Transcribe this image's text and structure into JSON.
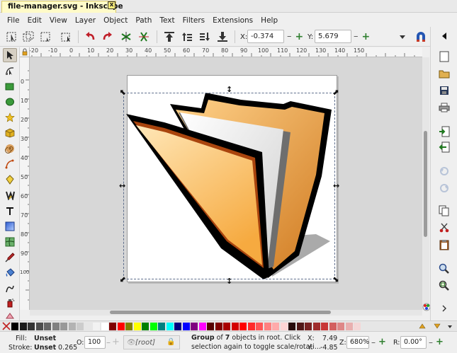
{
  "window": {
    "title_tab": "file-manager.svg - Inkscape",
    "close_glyph": "x"
  },
  "menubar": {
    "items": [
      "File",
      "Edit",
      "View",
      "Layer",
      "Object",
      "Path",
      "Text",
      "Filters",
      "Extensions",
      "Help"
    ]
  },
  "tool_controls": {
    "x_label": "X:",
    "x_value": "-0.374",
    "y_label": "Y:",
    "y_value": "5.679",
    "minus": "–",
    "plus": "+"
  },
  "rulers": {
    "top_labels": [
      "-20",
      "-10",
      "0",
      "10",
      "20",
      "30",
      "40",
      "50",
      "60",
      "70",
      "80",
      "90",
      "100",
      "110",
      "120",
      "130",
      "140",
      "150"
    ],
    "left_labels": [
      "0",
      "10",
      "20",
      "30",
      "40",
      "50",
      "60",
      "70",
      "80",
      "90",
      "100"
    ]
  },
  "statusbar": {
    "fill_label": "Fill:",
    "fill_value": "Unset",
    "stroke_label": "Stroke:",
    "stroke_value": "Unset",
    "stroke_width": "0.265",
    "opacity_label": "O:",
    "opacity_value": "100",
    "layer": "[root]",
    "message_line1_pre": "Group",
    "message_line1_mid": " of ",
    "message_line1_count": "7",
    "message_line1_post": " objects in root. Click",
    "message_line2": "selection again to toggle scale/rotati...",
    "cursor_x_label": "X:",
    "cursor_x": "7.49",
    "cursor_y_label": "Y:",
    "cursor_y": "-4.85",
    "zoom_label": "Z:",
    "zoom_value": "680%",
    "rotation_label": "R:",
    "rotation_value": "0.00°"
  },
  "palette_colors": [
    "#000000",
    "#1a1a1a",
    "#333333",
    "#4d4d4d",
    "#666666",
    "#808080",
    "#999999",
    "#b3b3b3",
    "#cccccc",
    "#e6e6e6",
    "#f2f2f2",
    "#ffffff",
    "#800000",
    "#ff0000",
    "#808000",
    "#ffff00",
    "#008000",
    "#00ff00",
    "#008080",
    "#00ffff",
    "#000080",
    "#0000ff",
    "#800080",
    "#ff00ff",
    "#550000",
    "#800000",
    "#aa0000",
    "#d40000",
    "#ff0000",
    "#ff2a2a",
    "#ff5555",
    "#ff8080",
    "#ffaaaa",
    "#ffd5d5",
    "#280b0b",
    "#501616",
    "#782121",
    "#a02c2c",
    "#c83737",
    "#d35f5f",
    "#de8787",
    "#e9afaf",
    "#f4d7d7"
  ],
  "icons": {
    "toolbox": [
      "selector-arrow-icon",
      "node-tool-icon",
      "rectangle-tool-icon",
      "ellipse-tool-icon",
      "star-tool-icon",
      "3d-box-tool-icon",
      "spiral-tool-icon",
      "pen-tool-icon",
      "pencil-tool-icon",
      "calligraphy-tool-icon",
      "text-tool-icon",
      "gradient-tool-icon",
      "mesh-tool-icon",
      "dropper-tool-icon",
      "paint-bucket-tool-icon",
      "tweak-tool-icon",
      "spray-tool-icon",
      "eraser-tool-icon",
      "connector-tool-icon"
    ]
  }
}
